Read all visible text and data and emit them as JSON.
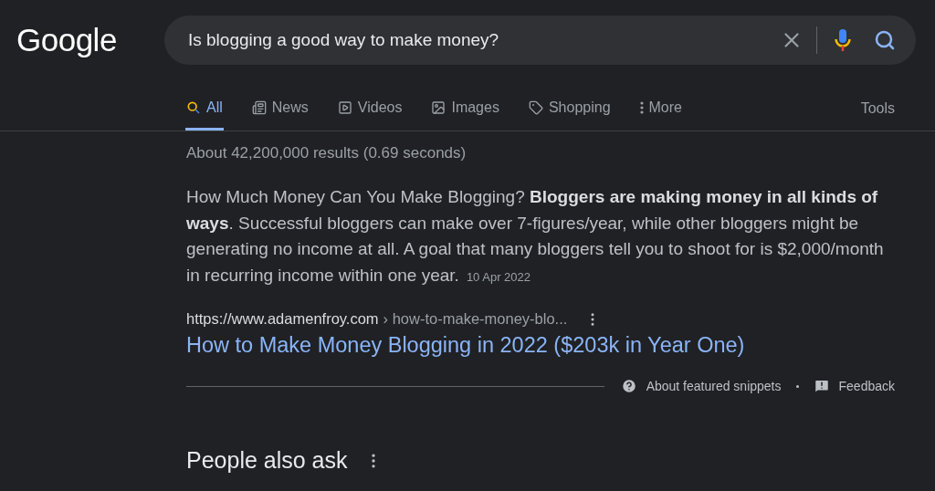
{
  "header": {
    "logo": "Google",
    "search": {
      "value": "Is blogging a good way to make money?"
    }
  },
  "tabs": [
    {
      "label": "All",
      "kind": "search",
      "selected": true
    },
    {
      "label": "News",
      "kind": "news",
      "selected": false
    },
    {
      "label": "Videos",
      "kind": "video",
      "selected": false
    },
    {
      "label": "Images",
      "kind": "image",
      "selected": false
    },
    {
      "label": "Shopping",
      "kind": "tag",
      "selected": false
    },
    {
      "label": "More",
      "kind": "more",
      "selected": false
    }
  ],
  "tools": "Tools",
  "result_stats": "About 42,200,000 results (0.69 seconds)",
  "snippet": {
    "text": "How Much Money Can You Make Blogging? **Bloggers are making money in all kinds of ways**. Successful bloggers can make over 7-figures/year, while other bloggers might be generating no income at all. A goal that many bloggers tell you to shoot for is $2,000/month in recurring income within one year.",
    "date": "10 Apr 2022",
    "url": "https://www.adamenfroy.com",
    "breadcrumb": "› how-to-make-money-blo...",
    "title": "How to Make Money Blogging in 2022 ($203k in Year One)"
  },
  "footer_links": [
    {
      "label": "About featured snippets",
      "kind": "help"
    },
    {
      "label": "Feedback",
      "kind": "feedback"
    }
  ],
  "people_also_ask": {
    "heading": "People also ask"
  }
}
